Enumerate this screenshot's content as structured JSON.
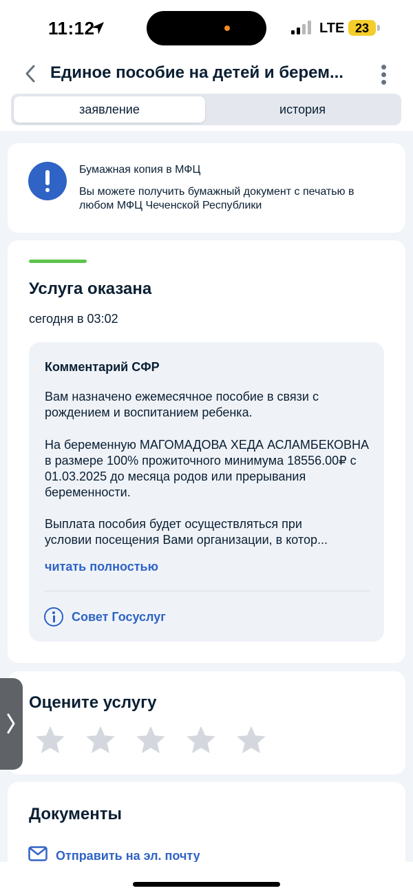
{
  "status_bar": {
    "time": "11:12",
    "network": "LTE",
    "battery": "23",
    "battery_color": "#f5cd2b",
    "icons": [
      "location-arrow-icon",
      "signal-icon",
      "battery-icon"
    ]
  },
  "header": {
    "title": "Единое пособие на детей и берем...",
    "icons": [
      "chevron-left-icon",
      "more-vertical-icon"
    ]
  },
  "tabs": [
    {
      "label": "заявление",
      "active": true
    },
    {
      "label": "история",
      "active": false
    }
  ],
  "mfc_card": {
    "icon": "exclamation-icon",
    "title": "Бумажная копия в МФЦ",
    "text": "Вы можете получить бумажный документ с печатью в любом МФЦ Чеченской Республики"
  },
  "status_card": {
    "accent_color": "#5ec24d",
    "title": "Услуга оказана",
    "time": "сегодня в 03:02",
    "comment": {
      "title": "Комментарий СФР",
      "paragraph_1": "Вам назначено ежемесячное пособие в связи с рождением и воспитанием ребенка.",
      "paragraph_2": "На беременную МАГОМАДОВА ХЕДА АСЛАМБЕКОВНА в размере 100% прожиточного минимума 18556.00₽ с 01.03.2025 до месяца родов или прерывания беременности.",
      "paragraph_3_line_1": "Выплата пособия будет осуществляться при",
      "paragraph_3_line_2": "условии посещения Вами организации, в котор...",
      "read_more": "читать полностью",
      "tip_label": "Совет Госуслуг"
    }
  },
  "rating_card": {
    "title": "Оцените услугу",
    "stars_total": 5,
    "stars_selected": 0
  },
  "documents_card": {
    "title": "Документы",
    "email_link": "Отправить на эл. почту"
  },
  "colors": {
    "brand_blue": "#2f63c5",
    "text_dark": "#0b1f33",
    "page_bg": "#f1f4f8",
    "comment_bg": "#eff3f8"
  }
}
